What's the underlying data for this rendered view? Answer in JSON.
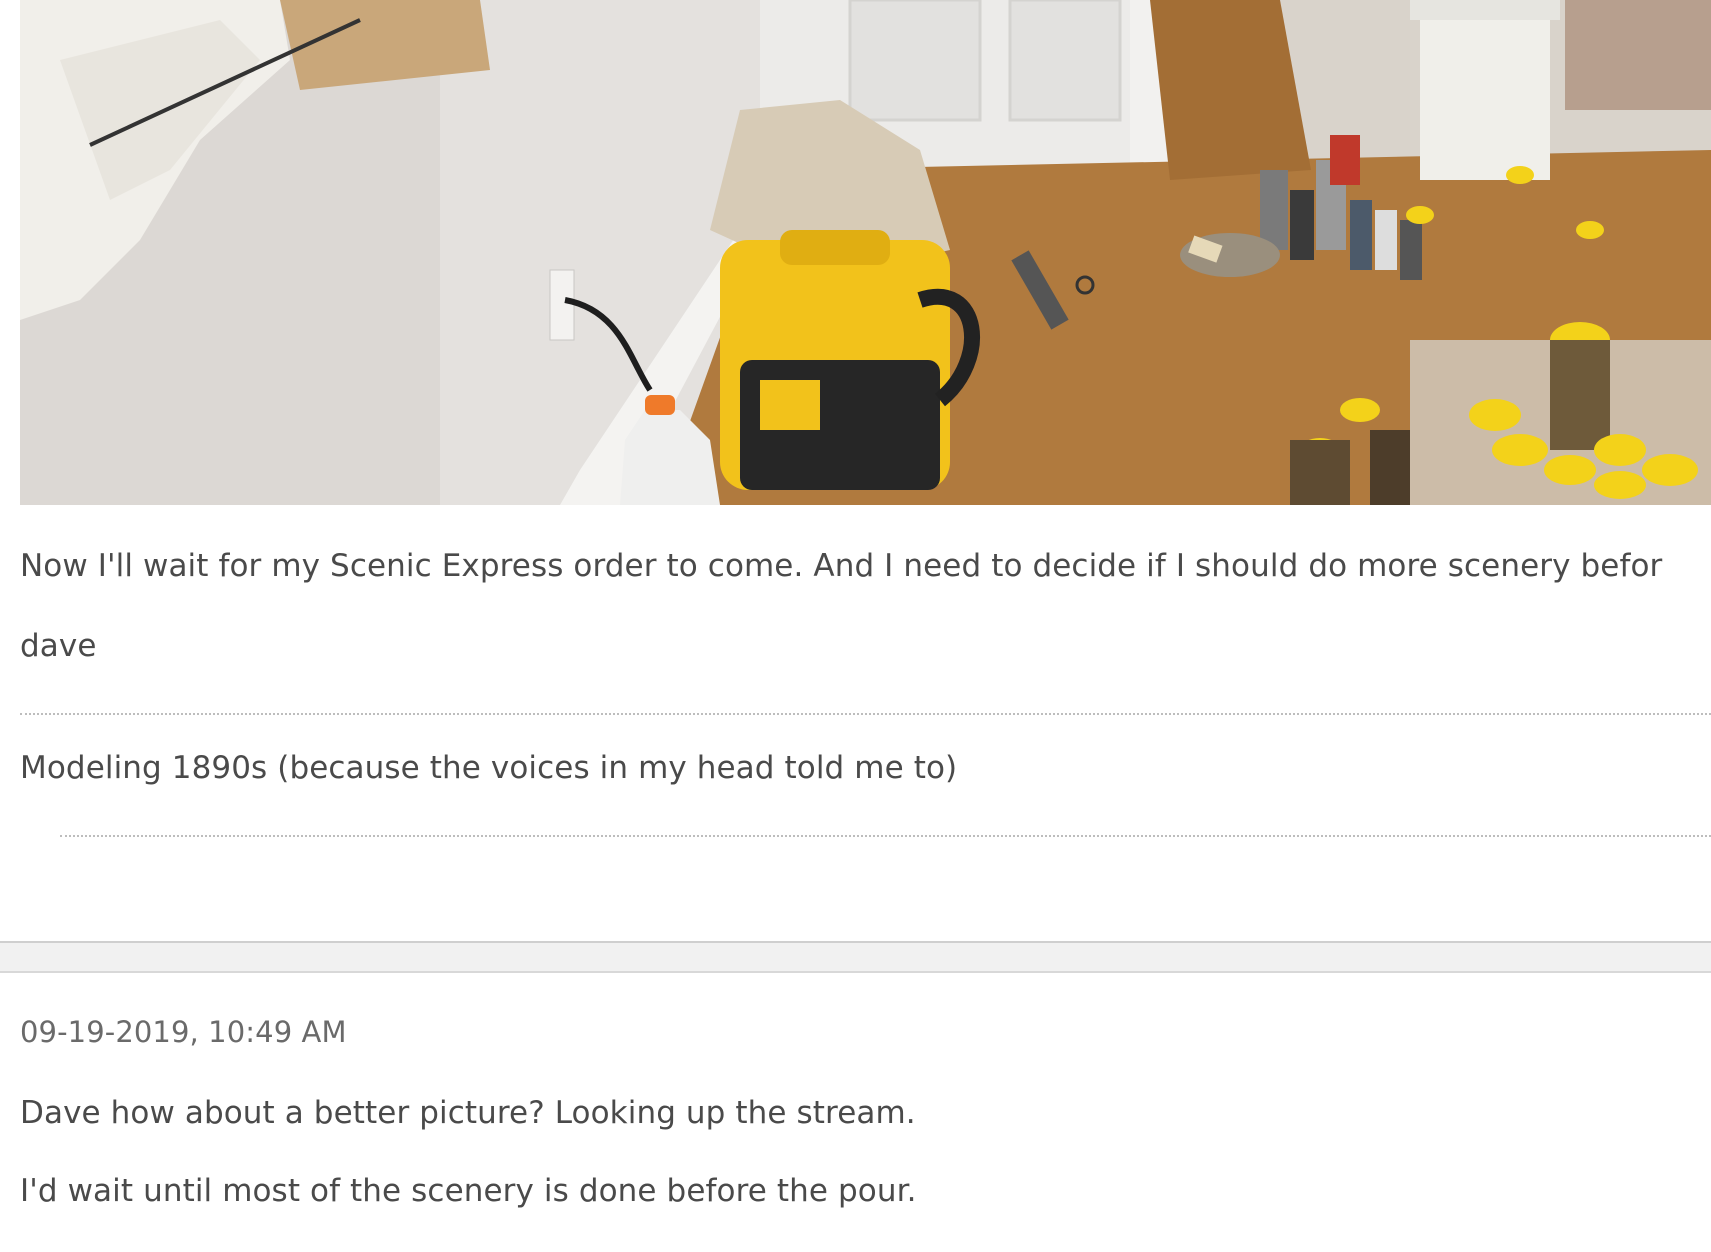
{
  "post": {
    "body_text": "Now I'll wait for my Scenic Express order to come. And I need to decide if I should do more scenery befor",
    "author": "dave",
    "signature": "Modeling 1890s (because the voices in my head told me to)"
  },
  "reply": {
    "timestamp": "09-19-2019, 10:49 AM",
    "lines": [
      "Dave how about a better picture? Looking up the stream.",
      "I'd wait until most of the scenery is done before the pour."
    ]
  },
  "colors": {
    "text": "#4a4a4a",
    "timestamp": "#6a6a6a",
    "vacuum_yellow": "#f2c21b",
    "floor_wood": "#b07a3e"
  }
}
